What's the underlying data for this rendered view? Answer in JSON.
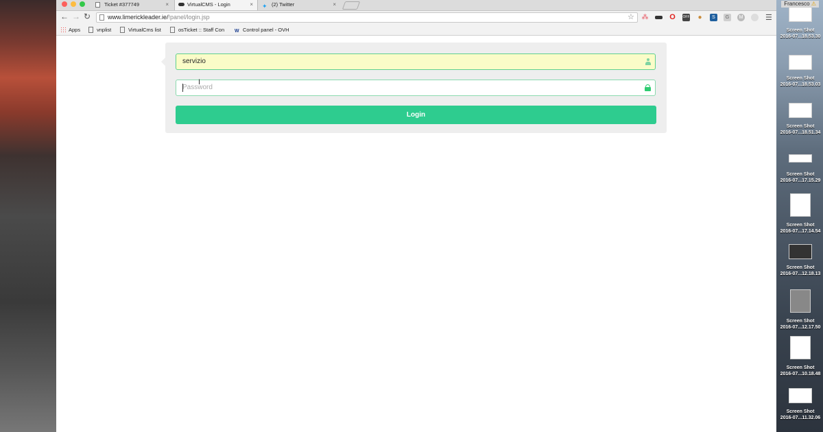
{
  "browser": {
    "tabs": [
      {
        "label": "Ticket #377749",
        "active": false
      },
      {
        "label": "VirtualCMS - Login",
        "active": true
      },
      {
        "label": "(2) Twitter",
        "active": false
      }
    ],
    "url_host": "www.limerickleader.ie/",
    "url_path": "!panel/login.jsp",
    "user": "Francesco",
    "bookmarks": [
      "Apps",
      "vnplist",
      "VirtualCms list",
      "osTicket :: Staff Con",
      "Control panel - OVH"
    ],
    "extensions": [
      "asana-icon",
      "mask-icon",
      "opera-icon",
      "off-icon",
      "cookie-icon",
      "s-icon",
      "g-icon",
      "m-icon"
    ]
  },
  "login": {
    "username_value": "servizio",
    "password_placeholder": "Password",
    "button_label": "Login"
  },
  "desktop": {
    "files": [
      {
        "line1": "Screen Shot",
        "line2": "2016-07...18.53.30"
      },
      {
        "line1": "Screen Shot",
        "line2": "2016-07...18.53.03"
      },
      {
        "line1": "Screen Shot",
        "line2": "2016-07...18.51.34"
      },
      {
        "line1": "Screen Shot",
        "line2": "2016-07...17.15.29"
      },
      {
        "line1": "Screen Shot",
        "line2": "2016-07...17.14.54"
      },
      {
        "line1": "Screen Shot",
        "line2": "2016-07...12.18.13"
      },
      {
        "line1": "Screen Shot",
        "line2": "2016-07...12.17.50"
      },
      {
        "line1": "Screen Shot",
        "line2": "2016-07...10.18.48"
      },
      {
        "line1": "Screen Shot",
        "line2": "2016-07...11.32.06"
      }
    ]
  }
}
